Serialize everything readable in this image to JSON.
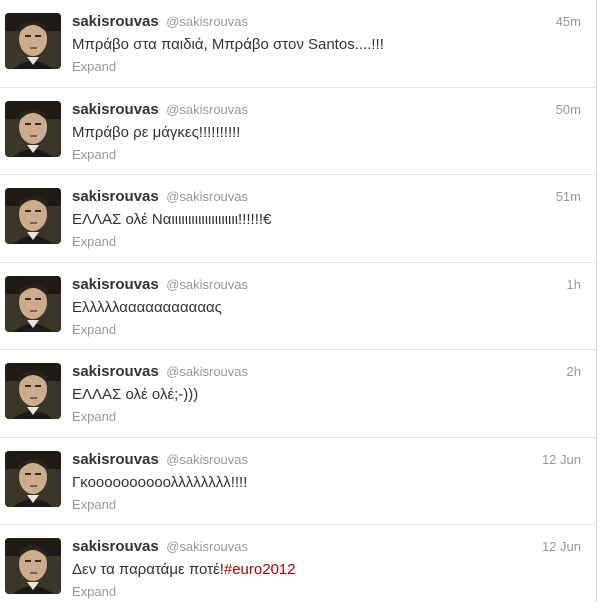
{
  "timeline": {
    "tweets": [
      {
        "fullname": "sakisrouvas",
        "username": "@sakisrouvas",
        "time": "45m",
        "text": "Μπράβο στα παιδιά, Μπράβο στον Santos....!!!",
        "hashtag": "",
        "expand": "Expand"
      },
      {
        "fullname": "sakisrouvas",
        "username": "@sakisrouvas",
        "time": "50m",
        "text": "Μπράβο ρε μάγκες!!!!!!!!!!",
        "hashtag": "",
        "expand": "Expand"
      },
      {
        "fullname": "sakisrouvas",
        "username": "@sakisrouvas",
        "time": "51m",
        "text": "ΕΛΛΑΣ ολέ Ναιιιιιιιιιιιιιιιιιιιι!!!!!!€",
        "hashtag": "",
        "expand": "Expand"
      },
      {
        "fullname": "sakisrouvas",
        "username": "@sakisrouvas",
        "time": "1h",
        "text": "Ελλλλλααααααααααας",
        "hashtag": "",
        "expand": "Expand"
      },
      {
        "fullname": "sakisrouvas",
        "username": "@sakisrouvas",
        "time": "2h",
        "text": "ΕΛΛΑΣ ολέ ολέ;-)))",
        "hashtag": "",
        "expand": "Expand"
      },
      {
        "fullname": "sakisrouvas",
        "username": "@sakisrouvas",
        "time": "12 Jun",
        "text": "Γκοοοοοοοοοολλλλλλλλ!!!!",
        "hashtag": "",
        "expand": "Expand"
      },
      {
        "fullname": "sakisrouvas",
        "username": "@sakisrouvas",
        "time": "12 Jun",
        "text": "Δεν τα παρατάμε ποτέ!",
        "hashtag": "#euro2012",
        "expand": "Expand"
      }
    ]
  },
  "colors": {
    "name": "#333333",
    "meta": "#999999",
    "hashtag": "#b30000",
    "divider": "#e6e6e6"
  },
  "icons": {
    "avatar": "user-avatar-photo"
  }
}
